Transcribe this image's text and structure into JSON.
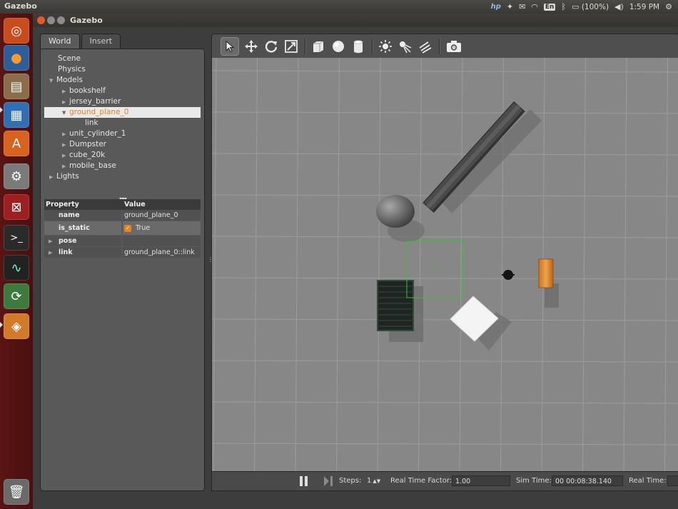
{
  "topbar": {
    "app_title": "Gazebo",
    "battery_text": "(100%)",
    "clock": "1:59 PM",
    "keyboard_layout": "En"
  },
  "launcher": {
    "items": [
      "ubuntu-dash",
      "firefox",
      "file-manager",
      "libreoffice-writer",
      "software-center",
      "system-settings",
      "remote-desktop",
      "terminal",
      "system-monitor",
      "software-updater",
      "gazebo"
    ]
  },
  "window": {
    "title": "Gazebo"
  },
  "left_panel": {
    "tabs": [
      {
        "label": "World"
      },
      {
        "label": "Insert"
      }
    ],
    "tree": {
      "scene": "Scene",
      "physics": "Physics",
      "models": "Models",
      "model_items": [
        "bookshelf",
        "jersey_barrier",
        "ground_plane_0",
        "link",
        "unit_cylinder_1",
        "Dumpster",
        "cube_20k",
        "mobile_base"
      ],
      "lights": "Lights"
    },
    "properties": {
      "header_property": "Property",
      "header_value": "Value",
      "name_key": "name",
      "name_value": "ground_plane_0",
      "is_static_key": "is_static",
      "is_static_value": "True",
      "pose_key": "pose",
      "link_key": "link",
      "link_value": "ground_plane_0::link"
    }
  },
  "bottom_bar": {
    "steps_label": "Steps:",
    "steps_value": "1",
    "rtf_label": "Real Time Factor:",
    "rtf_value": "1.00",
    "sim_time_label": "Sim Time:",
    "sim_time_value": "00 00:08:38.140",
    "real_time_label": "Real Time:"
  },
  "colors": {
    "launcher": "#5a1414",
    "selection_text": "#e8821e",
    "viewport": "#878787",
    "selection_box": "#39c03a"
  }
}
